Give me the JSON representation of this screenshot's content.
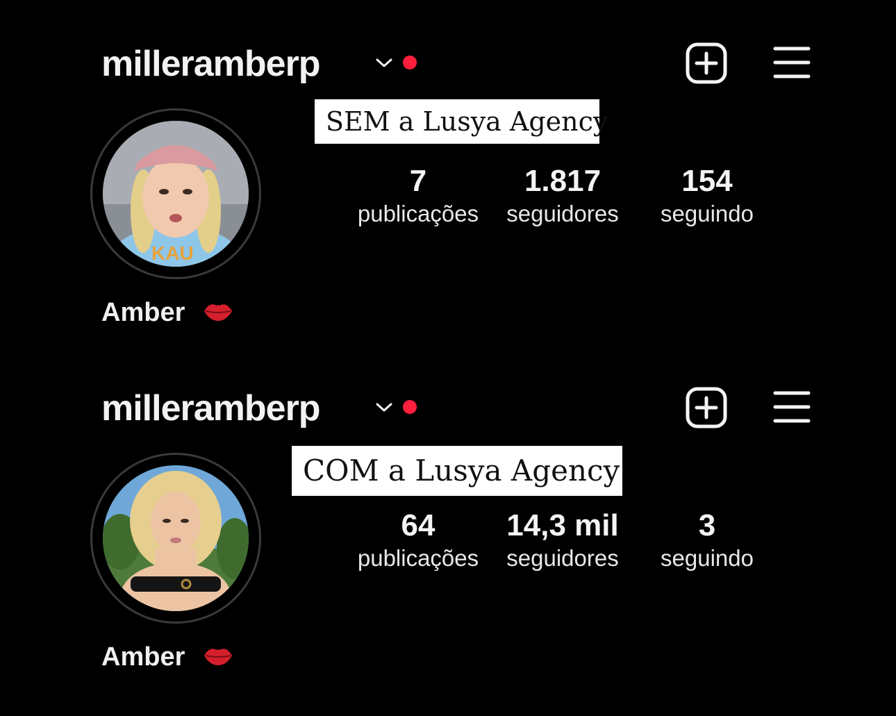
{
  "profiles": [
    {
      "username": "milleramberp",
      "caption": "SEM a Lusya Agency",
      "posts": {
        "value": "7",
        "label": "publicações"
      },
      "followers": {
        "value": "1.817",
        "label": "seguidores"
      },
      "following": {
        "value": "154",
        "label": "seguindo"
      },
      "display_name": "Amber",
      "avatar": "blonde-braids-pink-cap-photo"
    },
    {
      "username": "milleramberp",
      "caption": "COM a Lusya Agency",
      "posts": {
        "value": "64",
        "label": "publicações"
      },
      "followers": {
        "value": "14,3 mil",
        "label": "seguidores"
      },
      "following": {
        "value": "3",
        "label": "seguindo"
      },
      "display_name": "Amber",
      "avatar": "blonde-curly-hair-bikini-photo"
    }
  ],
  "icons": {
    "chevron": "chevron-down-icon",
    "live_dot": "notification-dot-icon",
    "create": "plus-square-icon",
    "menu": "hamburger-menu-icon",
    "emoji": "kiss-lips-icon"
  },
  "colors": {
    "background": "#000000",
    "notification_dot": "#ff1f3d",
    "caption_bg": "#ffffff"
  }
}
